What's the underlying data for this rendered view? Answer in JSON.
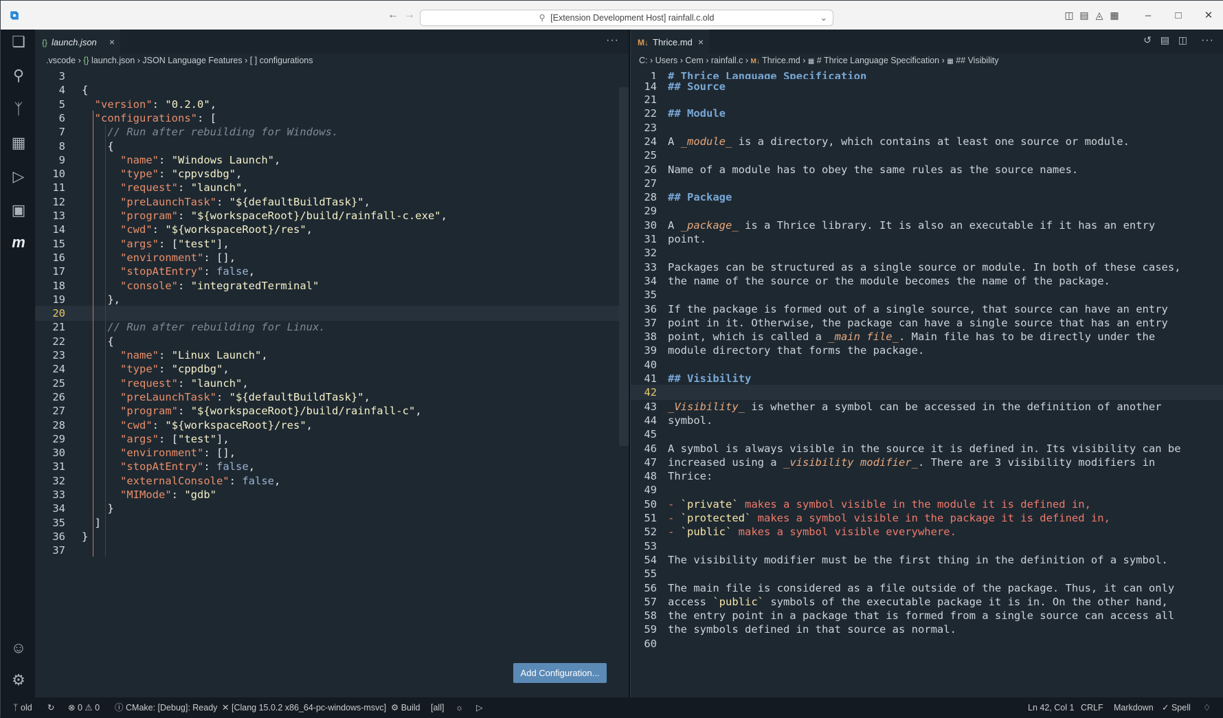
{
  "titlebar": {
    "search_text": "[Extension Development Host] rainfall.c.old"
  },
  "activity_bar": {
    "items": [
      "explorer-icon",
      "search-icon",
      "source-control-icon",
      "extensions-icon",
      "run-debug-icon",
      "remote-explorer-icon",
      "cmake-icon"
    ],
    "bottom": [
      "account-icon",
      "settings-gear-icon"
    ]
  },
  "left_editor": {
    "tab_label": "launch.json",
    "breadcrumbs": [
      ".vscode",
      "launch.json",
      "JSON Language Features",
      "[ ] configurations"
    ],
    "add_configuration_label": "Add Configuration...",
    "lines": [
      {
        "n": "3",
        "t": ""
      },
      {
        "n": "4",
        "t": "{"
      },
      {
        "n": "5",
        "t": "  \"version\": \"0.2.0\","
      },
      {
        "n": "6",
        "t": "  \"configurations\": ["
      },
      {
        "n": "7",
        "t": "    // Run after rebuilding for Windows."
      },
      {
        "n": "8",
        "t": "    {"
      },
      {
        "n": "9",
        "t": "      \"name\": \"Windows Launch\","
      },
      {
        "n": "10",
        "t": "      \"type\": \"cppvsdbg\","
      },
      {
        "n": "11",
        "t": "      \"request\": \"launch\","
      },
      {
        "n": "12",
        "t": "      \"preLaunchTask\": \"${defaultBuildTask}\","
      },
      {
        "n": "13",
        "t": "      \"program\": \"${workspaceRoot}/build/rainfall-c.exe\","
      },
      {
        "n": "14",
        "t": "      \"cwd\": \"${workspaceRoot}/res\","
      },
      {
        "n": "15",
        "t": "      \"args\": [\"test\"],"
      },
      {
        "n": "16",
        "t": "      \"environment\": [],"
      },
      {
        "n": "17",
        "t": "      \"stopAtEntry\": false,"
      },
      {
        "n": "18",
        "t": "      \"console\": \"integratedTerminal\""
      },
      {
        "n": "19",
        "t": "    },"
      },
      {
        "n": "20",
        "t": ""
      },
      {
        "n": "21",
        "t": "    // Run after rebuilding for Linux."
      },
      {
        "n": "22",
        "t": "    {"
      },
      {
        "n": "23",
        "t": "      \"name\": \"Linux Launch\","
      },
      {
        "n": "24",
        "t": "      \"type\": \"cppdbg\","
      },
      {
        "n": "25",
        "t": "      \"request\": \"launch\","
      },
      {
        "n": "26",
        "t": "      \"preLaunchTask\": \"${defaultBuildTask}\","
      },
      {
        "n": "27",
        "t": "      \"program\": \"${workspaceRoot}/build/rainfall-c\","
      },
      {
        "n": "28",
        "t": "      \"cwd\": \"${workspaceRoot}/res\","
      },
      {
        "n": "29",
        "t": "      \"args\": [\"test\"],"
      },
      {
        "n": "30",
        "t": "      \"environment\": [],"
      },
      {
        "n": "31",
        "t": "      \"stopAtEntry\": false,"
      },
      {
        "n": "32",
        "t": "      \"externalConsole\": false,"
      },
      {
        "n": "33",
        "t": "      \"MIMode\": \"gdb\""
      },
      {
        "n": "34",
        "t": "    }"
      },
      {
        "n": "35",
        "t": "  ]"
      },
      {
        "n": "36",
        "t": "}"
      },
      {
        "n": "37",
        "t": ""
      }
    ]
  },
  "right_editor": {
    "tab_label": "Thrice.md",
    "breadcrumbs": [
      "C:",
      "Users",
      "Cem",
      "rainfall.c",
      "Thrice.md",
      "# Thrice Language Specification",
      "## Visibility"
    ],
    "sticky": [
      {
        "n": "1",
        "t": "# Thrice Language Specification"
      },
      {
        "n": "14",
        "t": "## Source"
      }
    ],
    "lines": [
      {
        "n": "21",
        "t": ""
      },
      {
        "n": "22",
        "t": "## Module"
      },
      {
        "n": "23",
        "t": ""
      },
      {
        "n": "24",
        "t": "A _module_ is a directory, which contains at least one source or module."
      },
      {
        "n": "25",
        "t": ""
      },
      {
        "n": "26",
        "t": "Name of a module has to obey the same rules as the source names."
      },
      {
        "n": "27",
        "t": ""
      },
      {
        "n": "28",
        "t": "## Package"
      },
      {
        "n": "29",
        "t": ""
      },
      {
        "n": "30",
        "t": "A _package_ is a Thrice library. It is also an executable if it has an entry"
      },
      {
        "n": "31",
        "t": "point."
      },
      {
        "n": "32",
        "t": ""
      },
      {
        "n": "33",
        "t": "Packages can be structured as a single source or module. In both of these cases,"
      },
      {
        "n": "34",
        "t": "the name of the source or the module becomes the name of the package."
      },
      {
        "n": "35",
        "t": ""
      },
      {
        "n": "36",
        "t": "If the package is formed out of a single source, that source can have an entry"
      },
      {
        "n": "37",
        "t": "point in it. Otherwise, the package can have a single source that has an entry"
      },
      {
        "n": "38",
        "t": "point, which is called a _main file_. Main file has to be directly under the"
      },
      {
        "n": "39",
        "t": "module directory that forms the package."
      },
      {
        "n": "40",
        "t": ""
      },
      {
        "n": "41",
        "t": "## Visibility"
      },
      {
        "n": "42",
        "t": ""
      },
      {
        "n": "43",
        "t": "_Visibility_ is whether a symbol can be accessed in the definition of another"
      },
      {
        "n": "44",
        "t": "symbol."
      },
      {
        "n": "45",
        "t": ""
      },
      {
        "n": "46",
        "t": "A symbol is always visible in the source it is defined in. Its visibility can be"
      },
      {
        "n": "47",
        "t": "increased using a _visibility modifier_. There are 3 visibility modifiers in"
      },
      {
        "n": "48",
        "t": "Thrice:"
      },
      {
        "n": "49",
        "t": ""
      },
      {
        "n": "50",
        "t": "- `private` makes a symbol visible in the module it is defined in,"
      },
      {
        "n": "51",
        "t": "- `protected` makes a symbol visible in the package it is defined in,"
      },
      {
        "n": "52",
        "t": "- `public` makes a symbol visible everywhere."
      },
      {
        "n": "53",
        "t": ""
      },
      {
        "n": "54",
        "t": "The visibility modifier must be the first thing in the definition of a symbol."
      },
      {
        "n": "55",
        "t": ""
      },
      {
        "n": "56",
        "t": "The main file is considered as a file outside of the package. Thus, it can only"
      },
      {
        "n": "57",
        "t": "access `public` symbols of the executable package it is in. On the other hand,"
      },
      {
        "n": "58",
        "t": "the entry point in a package that is formed from a single source can access all"
      },
      {
        "n": "59",
        "t": "the symbols defined in that source as normal."
      },
      {
        "n": "60",
        "t": ""
      }
    ]
  },
  "statusbar": {
    "branch": "old",
    "problems": "0 ⚠ 0",
    "cmake": "CMake: [Debug]: Ready",
    "kit": "[Clang 15.0.2 x86_64-pc-windows-msvc]",
    "build": "Build",
    "target": "[all]",
    "cursor": "Ln 42, Col 1",
    "eol": "CRLF",
    "language": "Markdown",
    "spell": "Spell"
  }
}
